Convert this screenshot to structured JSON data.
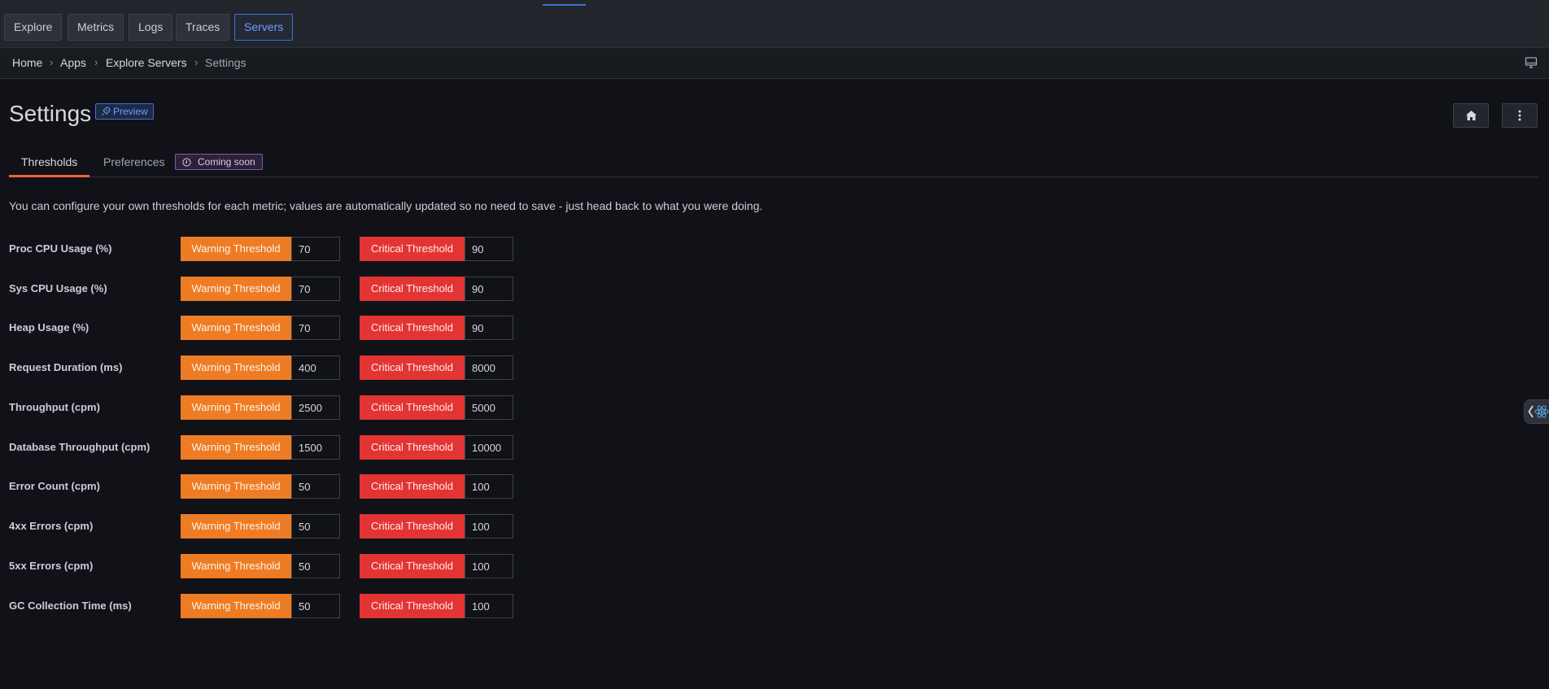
{
  "nav": {
    "buttons": [
      {
        "label": "Explore"
      },
      {
        "label": "Metrics"
      },
      {
        "label": "Logs"
      },
      {
        "label": "Traces"
      },
      {
        "label": "Servers"
      }
    ],
    "active": "Servers"
  },
  "breadcrumb": {
    "items": [
      "Home",
      "Apps",
      "Explore Servers",
      "Settings"
    ],
    "separator": "›"
  },
  "page": {
    "title": "Settings",
    "badge": "Preview"
  },
  "tabs": {
    "thresholds": "Thresholds",
    "preferences": "Preferences",
    "coming_soon": "Coming soon"
  },
  "description": "You can configure your own thresholds for each metric; values are automatically updated so no need to save - just head back to what you were doing.",
  "threshold_labels": {
    "warning": "Warning Threshold",
    "critical": "Critical Threshold"
  },
  "metrics": [
    {
      "label": "Proc CPU Usage (%)",
      "warning": "70",
      "critical": "90"
    },
    {
      "label": "Sys CPU Usage (%)",
      "warning": "70",
      "critical": "90"
    },
    {
      "label": "Heap Usage (%)",
      "warning": "70",
      "critical": "90"
    },
    {
      "label": "Request Duration (ms)",
      "warning": "400",
      "critical": "8000"
    },
    {
      "label": "Throughput (cpm)",
      "warning": "2500",
      "critical": "5000"
    },
    {
      "label": "Database Throughput (cpm)",
      "warning": "1500",
      "critical": "10000"
    },
    {
      "label": "Error Count (cpm)",
      "warning": "50",
      "critical": "100"
    },
    {
      "label": "4xx Errors (cpm)",
      "warning": "50",
      "critical": "100"
    },
    {
      "label": "5xx Errors (cpm)",
      "warning": "50",
      "critical": "100"
    },
    {
      "label": "GC Collection Time (ms)",
      "warning": "50",
      "critical": "100"
    }
  ],
  "colors": {
    "warning": "#ee7c24",
    "critical": "#e33434",
    "tab_accent": "#f55f3e",
    "primary": "#3d71d9"
  },
  "icons": {
    "preview": "rocket-icon",
    "coming_soon": "clock-icon",
    "home": "home-icon",
    "more": "kebab-menu-icon",
    "monitor": "monitor-icon",
    "sidebar": "react-icon"
  }
}
